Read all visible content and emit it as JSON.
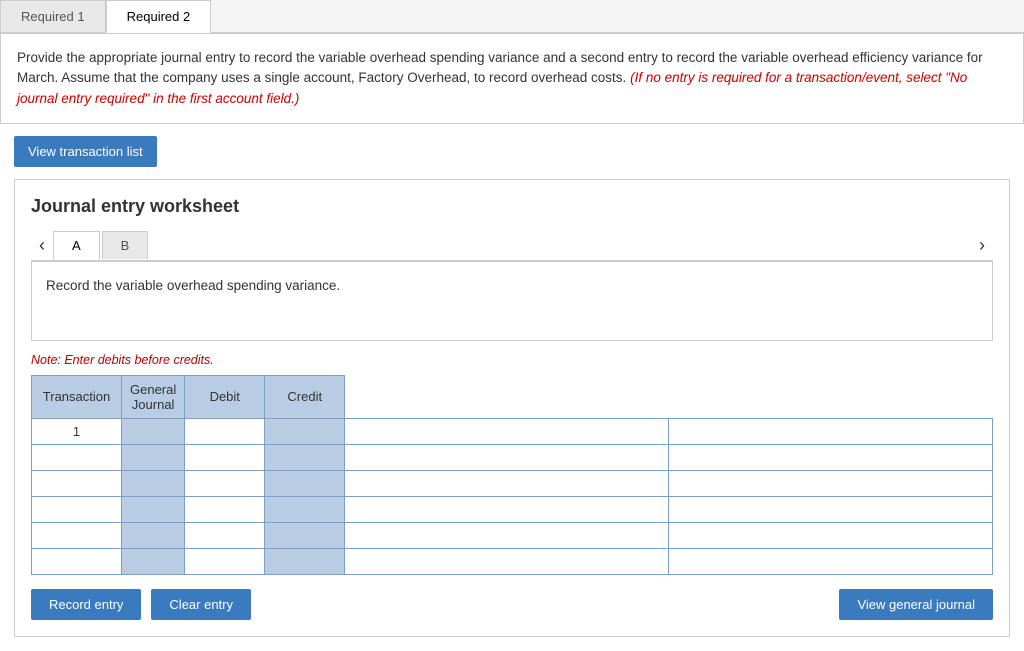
{
  "tabs": [
    {
      "label": "Required 1",
      "active": false
    },
    {
      "label": "Required 2",
      "active": false
    }
  ],
  "info_box": {
    "main_text": "Provide the appropriate journal entry to record the variable overhead spending variance and a second entry to record the variable overhead efficiency variance for March. Assume that the company uses a single account, Factory Overhead, to record overhead costs.",
    "italic_text": "(If no entry is required for a transaction/event, select \"No journal entry required\" in the first account field.)"
  },
  "view_transaction_list_btn": "View transaction list",
  "worksheet": {
    "title": "Journal entry worksheet",
    "tabs": [
      {
        "label": "A",
        "active": true
      },
      {
        "label": "B",
        "active": false
      }
    ],
    "description": "Record the variable overhead spending variance.",
    "note": "Note: Enter debits before credits.",
    "table": {
      "headers": [
        "Transaction",
        "General Journal",
        "Debit",
        "Credit"
      ],
      "rows": [
        {
          "transaction": "1",
          "general_journal": "",
          "debit": "",
          "credit": ""
        },
        {
          "transaction": "",
          "general_journal": "",
          "debit": "",
          "credit": ""
        },
        {
          "transaction": "",
          "general_journal": "",
          "debit": "",
          "credit": ""
        },
        {
          "transaction": "",
          "general_journal": "",
          "debit": "",
          "credit": ""
        },
        {
          "transaction": "",
          "general_journal": "",
          "debit": "",
          "credit": ""
        },
        {
          "transaction": "",
          "general_journal": "",
          "debit": "",
          "credit": ""
        }
      ]
    },
    "buttons": {
      "record_entry": "Record entry",
      "clear_entry": "Clear entry",
      "view_general_journal": "View general journal"
    }
  }
}
